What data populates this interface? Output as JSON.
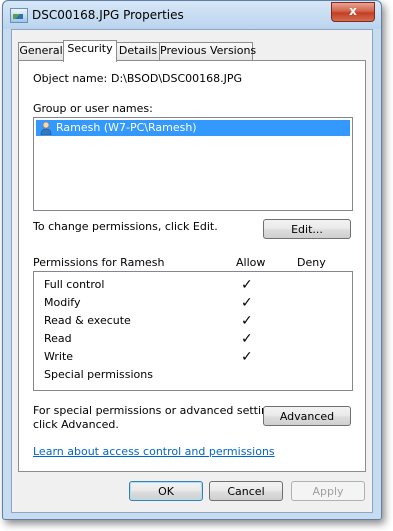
{
  "window": {
    "title": "DSC00168.JPG Properties",
    "close_glyph": "x"
  },
  "tabs": [
    {
      "label": "General"
    },
    {
      "label": "Security"
    },
    {
      "label": "Details"
    },
    {
      "label": "Previous Versions"
    }
  ],
  "security": {
    "object_name_label": "Object name:",
    "object_name_value": "D:\\BSOD\\DSC00168.JPG",
    "group_label": "Group or user names:",
    "users": [
      {
        "name": "Ramesh (W7-PC\\Ramesh)",
        "icon": "user-icon",
        "selected": true
      }
    ],
    "change_text": "To change permissions, click Edit.",
    "edit_button": "Edit...",
    "permissions_header": "Permissions for Ramesh",
    "allow_header": "Allow",
    "deny_header": "Deny",
    "permissions": [
      {
        "name": "Full control",
        "allow": "✓",
        "deny": ""
      },
      {
        "name": "Modify",
        "allow": "✓",
        "deny": ""
      },
      {
        "name": "Read & execute",
        "allow": "✓",
        "deny": ""
      },
      {
        "name": "Read",
        "allow": "✓",
        "deny": ""
      },
      {
        "name": "Write",
        "allow": "✓",
        "deny": ""
      },
      {
        "name": "Special permissions",
        "allow": "",
        "deny": ""
      }
    ],
    "advanced_text_line1": "For special permissions or advanced settings,",
    "advanced_text_line2": "click Advanced.",
    "advanced_button": "Advanced",
    "learn_link": "Learn about access control and permissions"
  },
  "footer": {
    "ok": "OK",
    "cancel": "Cancel",
    "apply": "Apply"
  },
  "colors": {
    "selection": "#3399ff",
    "link": "#0066cc",
    "close": "#c23f24"
  }
}
